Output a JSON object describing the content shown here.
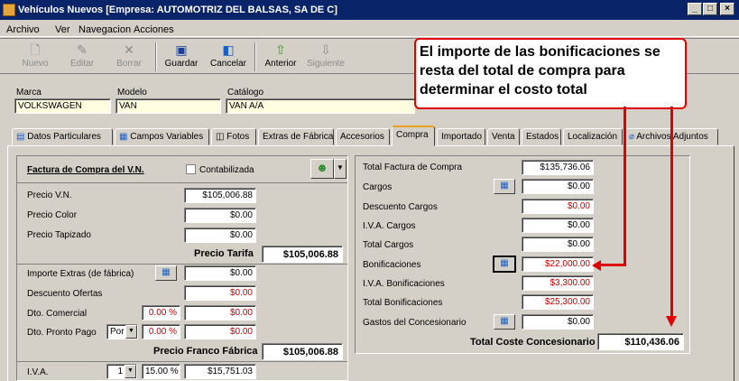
{
  "window": {
    "title": "Vehículos Nuevos [Empresa: AUTOMOTRIZ DEL BALSAS, SA DE C]"
  },
  "menu": [
    "Archivo",
    "Ver",
    "Navegacion",
    "Acciones"
  ],
  "toolbar": [
    {
      "label": "Nuevo",
      "icon": "new-doc-icon",
      "enabled": false
    },
    {
      "label": "Editar",
      "icon": "edit-icon",
      "enabled": false
    },
    {
      "label": "Borrar",
      "icon": "delete-icon",
      "enabled": false
    },
    {
      "label": "Guardar",
      "icon": "save-icon",
      "enabled": true
    },
    {
      "label": "Cancelar",
      "icon": "cancel-icon",
      "enabled": true
    },
    {
      "label": "Anterior",
      "icon": "up-arrow-icon",
      "enabled": true
    },
    {
      "label": "Siguiente",
      "icon": "down-arrow-icon",
      "enabled": false
    }
  ],
  "vehicle": {
    "marca_label": "Marca",
    "marca": "VOLKSWAGEN",
    "modelo_label": "Modelo",
    "modelo": "VAN",
    "catalogo_label": "Catálogo",
    "catalogo": "VAN A/A"
  },
  "tabs": [
    "Datos Particulares",
    "Campos Variables",
    "Fotos",
    "Extras de Fábrica",
    "Accesorios",
    "Compra",
    "Importado",
    "Venta",
    "Estados",
    "Localización",
    "Archivos Adjuntos"
  ],
  "active_tab": "Compra",
  "left": {
    "section_title": "Factura de Compra del V.N.",
    "contabilizada_label": "Contabilizada",
    "precio_vn_label": "Precio V.N.",
    "precio_vn": "$105,006.88",
    "precio_color_label": "Precio Color",
    "precio_color": "$0.00",
    "precio_tapizado_label": "Precio Tapizado",
    "precio_tapizado": "$0.00",
    "precio_tarifa_label": "Precio Tarifa",
    "precio_tarifa": "$105,006.88",
    "importe_extras_label": "Importe Extras (de fábrica)",
    "importe_extras": "$0.00",
    "descuento_ofertas_label": "Descuento Ofertas",
    "descuento_ofertas": "$0.00",
    "dto_comercial_label": "Dto. Comercial",
    "dto_comercial_pct": "0.00 %",
    "dto_comercial": "$0.00",
    "dto_pronto_label": "Dto. Pronto Pago",
    "dto_pronto_sel": "Por",
    "dto_pronto_pct": "0.00 %",
    "dto_pronto": "$0.00",
    "precio_franco_label": "Precio Franco Fábrica",
    "precio_franco": "$105,006.88",
    "iva_label": "I.V.A.",
    "iva_sel": "1",
    "iva_pct": "15.00 %",
    "iva": "$15,751.03"
  },
  "right": {
    "total_factura_label": "Total Factura de Compra",
    "total_factura": "$135,736.06",
    "cargos_label": "Cargos",
    "cargos": "$0.00",
    "descuento_cargos_label": "Descuento Cargos",
    "descuento_cargos": "$0.00",
    "iva_cargos_label": "I.V.A. Cargos",
    "iva_cargos": "$0.00",
    "total_cargos_label": "Total Cargos",
    "total_cargos": "$0.00",
    "bonificaciones_label": "Bonificaciones",
    "bonificaciones": "$22,000.00",
    "iva_bonificaciones_label": "I.V.A. Bonificaciones",
    "iva_bonificaciones": "$3,300.00",
    "total_bonificaciones_label": "Total Bonificaciones",
    "total_bonificaciones": "$25,300.00",
    "gastos_label": "Gastos del Concesionario",
    "gastos": "$0.00",
    "total_coste_label": "Total Coste Concesionario",
    "total_coste": "$110,436.06"
  },
  "callout": {
    "text": "El importe de las bonificaciones se resta del total de compra para determinar el costo total"
  },
  "colors": {
    "titlebar": "#0a246a",
    "callout_border": "#e00000",
    "negative": "#c00000",
    "yellow_field": "#fffde0"
  }
}
